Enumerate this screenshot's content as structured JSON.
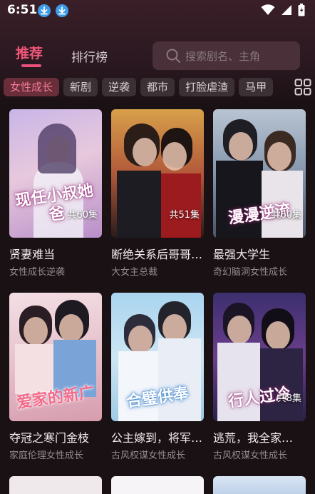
{
  "status_bar": {
    "time": "6:51"
  },
  "nav": {
    "tab_recommend": "推荐",
    "tab_rank": "排行榜",
    "search_placeholder": "搜索剧名、主角"
  },
  "categories": [
    "女性成长",
    "新剧",
    "逆袭",
    "都市",
    "打脸虐渣",
    "马甲"
  ],
  "dramas": [
    {
      "title": "贤妻难当",
      "tags": "女性成长逆袭",
      "poster_text": "现任小叔她爸",
      "episodes": "共60集"
    },
    {
      "title": "断绝关系后哥哥们…",
      "tags": "大女主总裁",
      "poster_text": "",
      "episodes": "共51集"
    },
    {
      "title": "最强大学生",
      "tags": "奇幻脑洞女性成长",
      "poster_text": "漫漫逆流",
      "episodes": "共60集"
    },
    {
      "title": "夺冠之寒门金枝",
      "tags": "家庭伦理女性成长",
      "poster_text": "爱家的新广",
      "episodes": ""
    },
    {
      "title": "公主嫁到，将军…",
      "tags": "古风权谋女性成长",
      "poster_text": "合璧供奉",
      "episodes": ""
    },
    {
      "title": "逃荒，我全家…",
      "tags": "古风权谋女性成长",
      "poster_text": "行人过冷",
      "episodes": "共8集"
    }
  ],
  "colors": {
    "accent": "#f0567a",
    "background": "#1a1114"
  }
}
